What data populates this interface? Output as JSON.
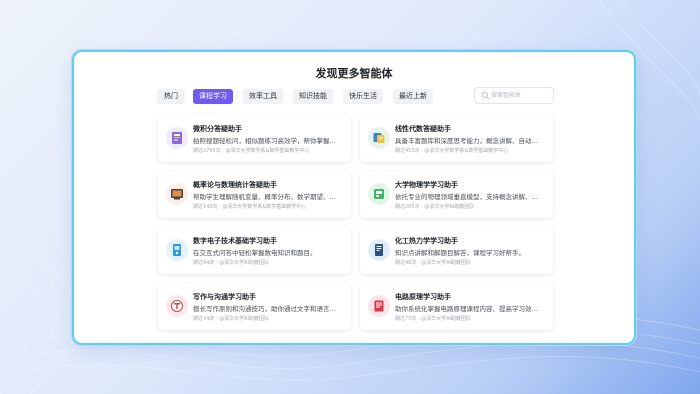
{
  "page": {
    "title": "发现更多智能体"
  },
  "tabs": [
    {
      "label": "热门",
      "active": false
    },
    {
      "label": "课程学习",
      "active": true
    },
    {
      "label": "效率工具",
      "active": false
    },
    {
      "label": "知识技能",
      "active": false
    },
    {
      "label": "快乐生活",
      "active": false
    },
    {
      "label": "最近上新",
      "active": false
    }
  ],
  "search": {
    "placeholder": "搜索智能体"
  },
  "cards": [
    {
      "title": "微积分答疑助手",
      "desc": "拍照搜题轻松问，相似题练习高效学，帮你掌握…",
      "meta": "期过2765次 · @清华大学数学系&数学基础教学中心",
      "icon": "calculus-icon",
      "icon_bg": "#f1ebfb"
    },
    {
      "title": "线性代数答疑助手",
      "desc": "具备丰富题库和深度思考能力，概念讲解、自动…",
      "meta": "期过453次 · @清华大学数学系&数学基础教学中心",
      "icon": "linear-algebra-icon",
      "icon_bg": "#e6f5ea"
    },
    {
      "title": "概率论与数理统计答疑助手",
      "desc": "帮助学生理解随机变量、概率分布、数学期望、…",
      "meta": "期过142次 · @清华大学数学系&数学基础教学中心",
      "icon": "probability-icon",
      "icon_bg": "#fbeee4"
    },
    {
      "title": "大学物理学学习助手",
      "desc": "依托专业的物理领域垂直模型，支持概念讲解、…",
      "meta": "期过205次 · @清华大学AI助教团队",
      "icon": "physics-icon",
      "icon_bg": "#e4f5e8"
    },
    {
      "title": "数字电子技术基础学习助手",
      "desc": "在交互式问答中轻松掌握数电知识和题目。",
      "meta": "期过64次 · @清华大学AI助教团队",
      "icon": "digital-electronics-icon",
      "icon_bg": "#e4f1fb"
    },
    {
      "title": "化工热力学学习助手",
      "desc": "知识点讲解和解题目解答，课程学习好帮手。",
      "meta": "期过40次 · @清华大学AI助教团队",
      "icon": "chemical-thermo-icon",
      "icon_bg": "#e3ecf9"
    },
    {
      "title": "写作与沟通学习助手",
      "desc": "擅长写作原则和沟通技巧，助你通过文字和语言…",
      "meta": "期过74次 · @清华大学AI助教团队",
      "icon": "writing-icon",
      "icon_bg": "#fbe8e8"
    },
    {
      "title": "电路原理学习助手",
      "desc": "助你系统化掌握电路原理课程内容、提高学习效…",
      "meta": "期过77次 · @清华大学AI助教团队",
      "icon": "circuit-icon",
      "icon_bg": "#fbe5e7"
    }
  ],
  "colors": {
    "accent": "#6f5bf0",
    "panel_border": "#5fd0e8"
  }
}
